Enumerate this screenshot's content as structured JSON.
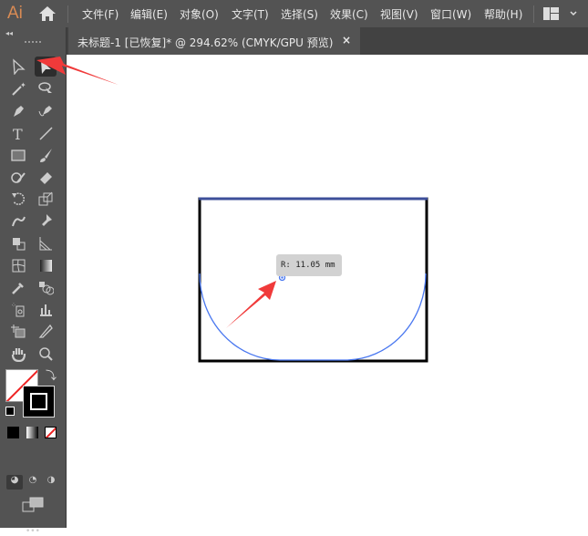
{
  "app": {
    "logo": "Ai"
  },
  "menu": [
    "文件(F)",
    "编辑(E)",
    "对象(O)",
    "文字(T)",
    "选择(S)",
    "效果(C)",
    "视图(V)",
    "窗口(W)",
    "帮助(H)"
  ],
  "tab": {
    "title": "未标题-1 [已恢复]* @ 294.62% (CMYK/GPU 预览)",
    "close": "×"
  },
  "toolbar": {
    "collapse": "◂◂",
    "more": "•••"
  },
  "tooltip": {
    "text": "R: 11.05 mm"
  },
  "colors": {
    "accent": "#d98b54",
    "selection": "#3d5cd6",
    "arrow": "#f03a3a"
  }
}
